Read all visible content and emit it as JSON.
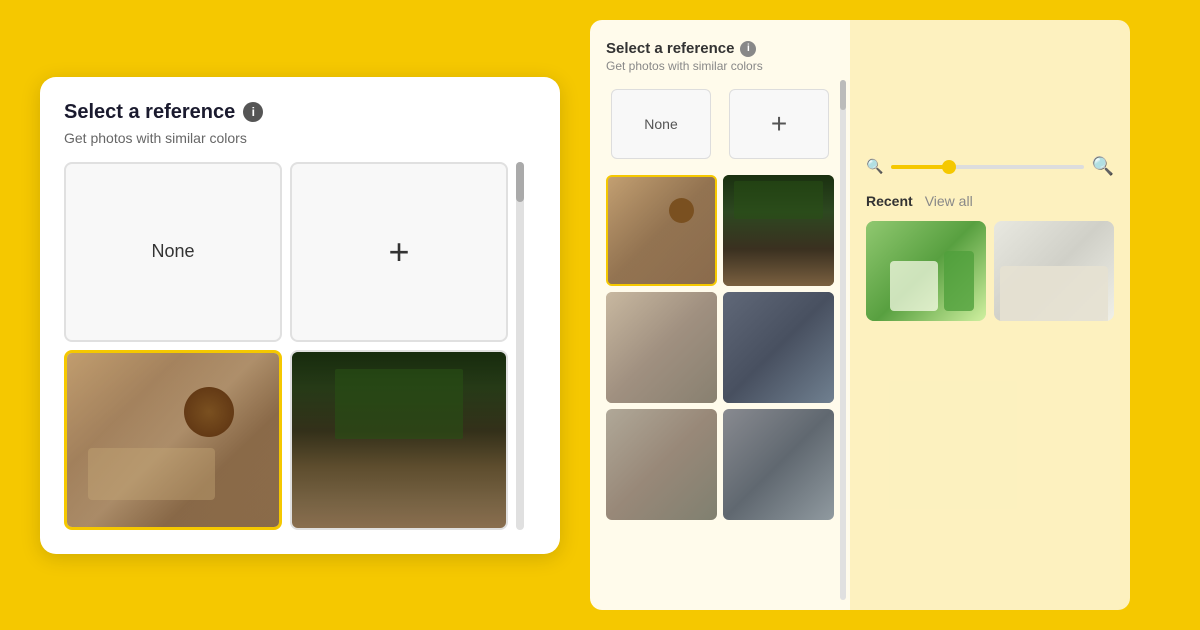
{
  "left": {
    "title": "Select a reference",
    "info_icon": "i",
    "subtitle": "Get photos with similar colors",
    "none_label": "None",
    "plus_label": "+",
    "cards": [
      {
        "id": "none",
        "type": "none"
      },
      {
        "id": "plus",
        "type": "plus"
      },
      {
        "id": "room1",
        "type": "image",
        "selected": true
      },
      {
        "id": "room2",
        "type": "image",
        "selected": false
      }
    ]
  },
  "right": {
    "title": "Select a reference",
    "info_icon": "i",
    "subtitle": "Get photos with similar colors",
    "none_label": "None",
    "plus_label": "+",
    "thumbs": [
      {
        "id": "r1",
        "selected": true
      },
      {
        "id": "r2",
        "selected": false
      },
      {
        "id": "r3",
        "selected": false
      },
      {
        "id": "r4",
        "selected": false
      },
      {
        "id": "r5",
        "selected": false
      },
      {
        "id": "r6",
        "selected": false
      }
    ]
  },
  "side": {
    "zoom_min_icon": "🔍",
    "zoom_max_icon": "🔍",
    "recent_label": "Recent",
    "viewall_label": "View all",
    "recent_thumbs": [
      {
        "id": "rec1"
      },
      {
        "id": "rec2"
      }
    ]
  }
}
